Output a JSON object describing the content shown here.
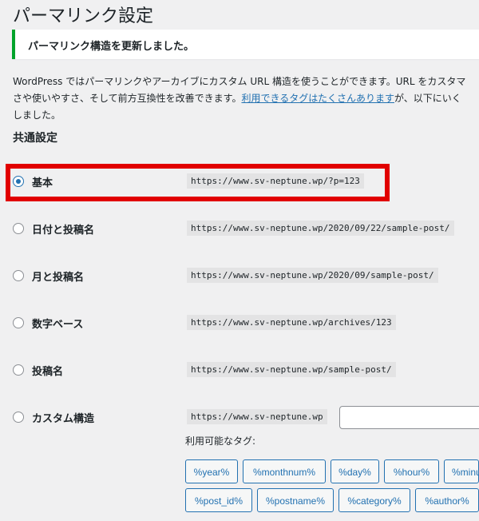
{
  "header": {
    "title": "パーマリンク設定"
  },
  "notice": {
    "text": "パーマリンク構造を更新しました。"
  },
  "intro": {
    "line1": "WordPress ではパーマリンクやアーカイブにカスタム URL 構造を使うことができます。URL をカスタマ",
    "line2_pre": "さや使いやすさ、そして前方互換性を改善できます。",
    "line2_link": "利用できるタグはたくさんあります",
    "line2_post": "が、以下にいく",
    "line3": "しました。"
  },
  "common": {
    "title": "共通設定",
    "options": [
      {
        "label": "基本",
        "example": "https://www.sv-neptune.wp/?p=123",
        "checked": true
      },
      {
        "label": "日付と投稿名",
        "example": "https://www.sv-neptune.wp/2020/09/22/sample-post/",
        "checked": false
      },
      {
        "label": "月と投稿名",
        "example": "https://www.sv-neptune.wp/2020/09/sample-post/",
        "checked": false
      },
      {
        "label": "数字ベース",
        "example": "https://www.sv-neptune.wp/archives/123",
        "checked": false
      },
      {
        "label": "投稿名",
        "example": "https://www.sv-neptune.wp/sample-post/",
        "checked": false
      },
      {
        "label": "カスタム構造",
        "example": "https://www.sv-neptune.wp",
        "checked": false
      }
    ],
    "custom_value": "",
    "tags_label": "利用可能なタグ:",
    "tags_row1": [
      "%year%",
      "%monthnum%",
      "%day%",
      "%hour%",
      "%minute%"
    ],
    "tags_row2": [
      "%post_id%",
      "%postname%",
      "%category%",
      "%author%"
    ]
  },
  "colors": {
    "accent": "#2271b1",
    "highlight": "#e10000",
    "success": "#00a32a"
  }
}
